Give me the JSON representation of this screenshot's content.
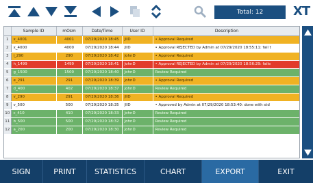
{
  "toolbar": {
    "icons": [
      "first-page-icon",
      "page-up-icon",
      "page-down-icon",
      "last-page-icon",
      "prev-icon",
      "next-icon",
      "copy-icon",
      "sort-icon",
      "search-icon"
    ],
    "total_label": "Total: 12",
    "brand": "XT"
  },
  "grid": {
    "columns": [
      "",
      "Sample ID",
      "mOsm",
      "Date/Time",
      "User ID",
      "Description"
    ],
    "rows": [
      {
        "n": "1",
        "sample": "x_4001",
        "mosm": "4001",
        "dt": "07/29/2020 18:45",
        "user": "JIID",
        "desc": "• Approval Required",
        "status": "orange"
      },
      {
        "n": "2",
        "sample": "x_4000",
        "mosm": "4000",
        "dt": "07/29/2020 18:44",
        "user": "JIID",
        "desc": "• Approval REJECTED by Admin  at  07/29/2020 18:55:11: fail t",
        "status": "white"
      },
      {
        "n": "3",
        "sample": "i_290",
        "mosm": "290",
        "dt": "07/29/2020 18:42",
        "user": "JohnD",
        "desc": "• Approval Required",
        "status": "orange"
      },
      {
        "n": "4",
        "sample": "h_1499",
        "mosm": "1499",
        "dt": "07/29/2020 18:41",
        "user": "JohnD",
        "desc": "• Approval REJECTED by Admin  at  07/29/2020 18:56:29: faile",
        "status": "red"
      },
      {
        "n": "5",
        "sample": "g_1500",
        "mosm": "1500",
        "dt": "07/29/2020 18:40",
        "user": "JohnD",
        "desc": "Review Required",
        "status": "green"
      },
      {
        "n": "6",
        "sample": "e_291",
        "mosm": "291",
        "dt": "07/29/2020 18:39",
        "user": "JohnD",
        "desc": "• Approval Required",
        "status": "orange"
      },
      {
        "n": "7",
        "sample": "d_400",
        "mosm": "402",
        "dt": "07/29/2020 18:37",
        "user": "JohnD",
        "desc": "Review Required",
        "status": "green"
      },
      {
        "n": "8",
        "sample": "v_290",
        "mosm": "291",
        "dt": "07/29/2020 18:36",
        "user": "JIID",
        "desc": "• Approval Required",
        "status": "orange"
      },
      {
        "n": "9",
        "sample": "v_500",
        "mosm": "500",
        "dt": "07/29/2020 18:35",
        "user": "JIID",
        "desc": "• Approved by Admin  at  07/29/2020 18:53:40: done with std",
        "status": "white"
      },
      {
        "n": "10",
        "sample": "c_410",
        "mosm": "410",
        "dt": "07/29/2020 18:33",
        "user": "JohnD",
        "desc": "Review Required",
        "status": "green"
      },
      {
        "n": "11",
        "sample": "b_500",
        "mosm": "500",
        "dt": "07/29/2020 18:32",
        "user": "JohnD",
        "desc": "Review Required",
        "status": "green"
      },
      {
        "n": "12",
        "sample": "a_200",
        "mosm": "200",
        "dt": "07/29/2020 18:30",
        "user": "JohnD",
        "desc": "Review Required",
        "status": "green"
      }
    ]
  },
  "bottombar": {
    "buttons": [
      {
        "label": "SIGN",
        "active": false
      },
      {
        "label": "PRINT",
        "active": false
      },
      {
        "label": "STATISTICS",
        "active": false
      },
      {
        "label": "CHART",
        "active": false
      },
      {
        "label": "EXPORT",
        "active": true
      },
      {
        "label": "EXIT",
        "active": false
      }
    ]
  },
  "colors": {
    "primary": "#1b4f80",
    "orange": "#f0b223",
    "red": "#e23b2a",
    "green": "#6cb26a"
  }
}
